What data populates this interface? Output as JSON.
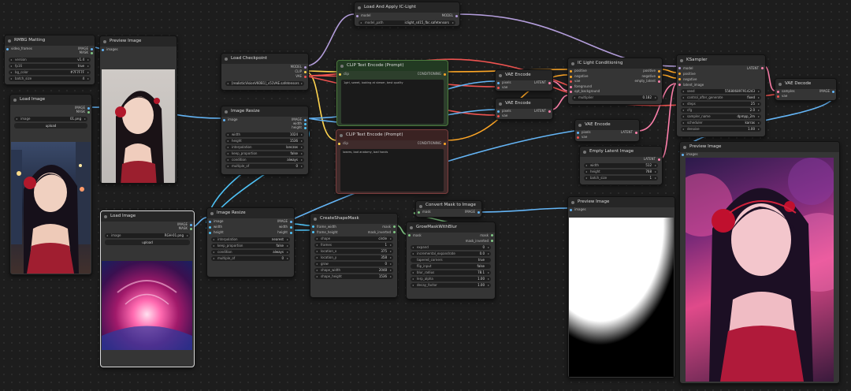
{
  "nodes": {
    "rmbg": {
      "title": "RMBG Matting",
      "outputs": [
        "IMAGE",
        "MASK"
      ],
      "inputs": [
        "video_frames"
      ],
      "widgets": [
        {
          "n": "version",
          "v": "v1.4"
        },
        {
          "n": "fp16",
          "v": "true"
        },
        {
          "n": "bg_color",
          "v": "#7F7F7F"
        },
        {
          "n": "batch_size",
          "v": "4"
        }
      ]
    },
    "preview1": {
      "title": "Preview Image",
      "inputs": [
        "images"
      ]
    },
    "load_image1": {
      "title": "Load Image",
      "outputs": [
        "IMAGE",
        "MASK"
      ],
      "image": "01.png",
      "upload": "upload"
    },
    "load_ckpt": {
      "title": "Load Checkpoint",
      "outputs": [
        "MODEL",
        "CLIP",
        "VAE"
      ],
      "ckpt": "[realisticVisionV60B1]_v51VAE.safetensors"
    },
    "iclight_load": {
      "title": "Load And Apply IC-Light",
      "inputs": [
        "model"
      ],
      "outputs": [
        "MODEL"
      ],
      "model_path": "iclight_sd15_fbc.safetensors"
    },
    "clip_pos": {
      "title": "CLIP Text Encode (Prompt)",
      "inputs": [
        "clip"
      ],
      "outputs": [
        "CONDITIONING"
      ],
      "text": "1girl, sweet, looking at viewer, best quality"
    },
    "clip_neg": {
      "title": "CLIP Text Encode (Prompt)",
      "inputs": [
        "clip"
      ],
      "outputs": [
        "CONDITIONING"
      ],
      "text": "lowres, bad anatomy, bad hands"
    },
    "image_resize": {
      "title": "Image Resize",
      "inputs": [
        "image"
      ],
      "outputs": [
        "IMAGE",
        "width",
        "height"
      ],
      "widgets": [
        {
          "n": "width",
          "v": "1024"
        },
        {
          "n": "height",
          "v": "1536"
        },
        {
          "n": "interpolation",
          "v": "lanczos"
        },
        {
          "n": "keep_proportion",
          "v": "false"
        },
        {
          "n": "condition",
          "v": "always"
        },
        {
          "n": "multiple_of",
          "v": "0"
        }
      ]
    },
    "vae_encode1": {
      "title": "VAE Encode",
      "inputs": [
        "pixels",
        "vae"
      ],
      "outputs": [
        "LATENT"
      ]
    },
    "vae_encode2": {
      "title": "VAE Encode",
      "inputs": [
        "pixels",
        "vae"
      ],
      "outputs": [
        "LATENT"
      ]
    },
    "iclight_cond": {
      "title": "IC Light Conditioning",
      "inputs": [
        "positive",
        "negative",
        "vae",
        "foreground",
        "opt_background"
      ],
      "outputs": [
        "positive",
        "negative",
        "empty_latent"
      ],
      "widgets": [
        {
          "n": "multiplier",
          "v": "0.182"
        }
      ]
    },
    "ksampler": {
      "title": "KSampler",
      "inputs": [
        "model",
        "positive",
        "negative",
        "latent_image"
      ],
      "outputs": [
        "LATENT"
      ],
      "widgets": [
        {
          "n": "seed",
          "v": "556806897914243"
        },
        {
          "n": "control_after_generate",
          "v": "fixed"
        },
        {
          "n": "steps",
          "v": "25"
        },
        {
          "n": "cfg",
          "v": "2.0"
        },
        {
          "n": "sampler_name",
          "v": "dpmpp_2m"
        },
        {
          "n": "scheduler",
          "v": "karras"
        },
        {
          "n": "denoise",
          "v": "1.00"
        }
      ]
    },
    "vae_decode": {
      "title": "VAE Decode",
      "inputs": [
        "samples",
        "vae"
      ],
      "outputs": [
        "IMAGE"
      ]
    },
    "vae_encode3": {
      "title": "VAE Encode",
      "inputs": [
        "pixels",
        "vae"
      ],
      "outputs": [
        "LATENT"
      ]
    },
    "empty_latent": {
      "title": "Empty Latent Image",
      "outputs": [
        "LATENT"
      ],
      "widgets": [
        {
          "n": "width",
          "v": "512"
        },
        {
          "n": "height",
          "v": "768"
        },
        {
          "n": "batch_size",
          "v": "1"
        }
      ]
    },
    "preview_main": {
      "title": "Preview Image",
      "inputs": [
        "images"
      ]
    },
    "load_image2": {
      "title": "Load Image",
      "outputs": [
        "IMAGE",
        "MASK"
      ],
      "image": "RGH-01.png",
      "upload": "upload"
    },
    "image_resize2": {
      "title": "Image Resize",
      "inputs": [
        "image",
        "width",
        "height"
      ],
      "outputs": [
        "IMAGE",
        "width",
        "height"
      ],
      "widgets": [
        {
          "n": "interpolation",
          "v": "nearest"
        },
        {
          "n": "keep_proportion",
          "v": "false"
        },
        {
          "n": "condition",
          "v": "always"
        },
        {
          "n": "multiple_of",
          "v": "0"
        }
      ]
    },
    "create_shape": {
      "title": "CreateShapeMask",
      "inputs": [
        "frame_width",
        "frame_height"
      ],
      "outputs": [
        "mask",
        "mask_inverted"
      ],
      "widgets": [
        {
          "n": "shape",
          "v": "circle"
        },
        {
          "n": "frames",
          "v": "1"
        },
        {
          "n": "location_x",
          "v": "375"
        },
        {
          "n": "location_y",
          "v": "358"
        },
        {
          "n": "grow",
          "v": "0"
        },
        {
          "n": "shape_width",
          "v": "2048"
        },
        {
          "n": "shape_height",
          "v": "1536"
        }
      ]
    },
    "grow_mask": {
      "title": "GrowMaskWithBlur",
      "inputs": [
        "mask"
      ],
      "outputs": [
        "mask",
        "mask_inverted"
      ],
      "widgets": [
        {
          "n": "expand",
          "v": "0"
        },
        {
          "n": "incremental_expandrate",
          "v": "0.0"
        },
        {
          "n": "tapered_corners",
          "v": "true"
        },
        {
          "n": "flip_input",
          "v": "false"
        },
        {
          "n": "blur_radius",
          "v": "78.1"
        },
        {
          "n": "lerp_alpha",
          "v": "1.00"
        },
        {
          "n": "decay_factor",
          "v": "1.00"
        }
      ]
    },
    "convert_mask": {
      "title": "Convert Mask to Image",
      "inputs": [
        "mask"
      ],
      "outputs": [
        "IMAGE"
      ]
    },
    "preview_mask": {
      "title": "Preview Image",
      "inputs": [
        "images"
      ]
    }
  },
  "colors": {
    "image": "#64b5f6",
    "mask": "#81c784",
    "model": "#b39ddb",
    "clip": "#ffd54f",
    "vae": "#ef5350",
    "conditioning": "#ffa726",
    "latent": "#ff80ab",
    "int": "#4fc3f7"
  }
}
